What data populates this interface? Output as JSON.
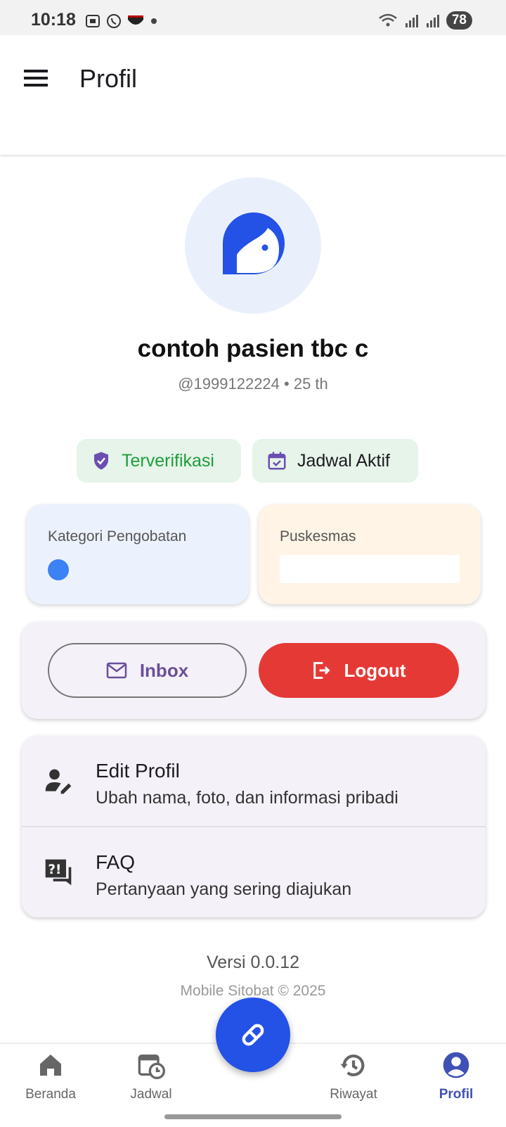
{
  "status": {
    "time": "10:18",
    "battery": "78"
  },
  "appbar": {
    "title": "Profil"
  },
  "profile": {
    "name": "contoh pasien tbc c",
    "subtitle": "@1999122224 • 25 th"
  },
  "chips": {
    "verified": "Terverifikasi",
    "schedule": "Jadwal Aktif"
  },
  "info": {
    "kategori_label": "Kategori Pengobatan",
    "puskesmas_label": "Puskesmas",
    "puskesmas_value": ""
  },
  "actions": {
    "inbox": "Inbox",
    "logout": "Logout"
  },
  "menu": {
    "items": [
      {
        "title": "Edit Profil",
        "desc": "Ubah nama, foto, dan informasi pribadi",
        "icon": "edit-person-icon"
      },
      {
        "title": "FAQ",
        "desc": "Pertanyaan yang sering diajukan",
        "icon": "faq-icon"
      }
    ]
  },
  "footer": {
    "version": "Versi 0.0.12",
    "copyright": "Mobile Sitobat © 2025"
  },
  "nav": {
    "items": [
      {
        "label": "Beranda",
        "icon": "home-icon"
      },
      {
        "label": "Jadwal",
        "icon": "calendar-clock-icon"
      },
      {
        "label": "Riwayat",
        "icon": "history-icon"
      },
      {
        "label": "Profil",
        "icon": "account-circle-icon",
        "active": true
      }
    ]
  },
  "colors": {
    "primary": "#2451e6",
    "logout": "#e53935",
    "verified": "#1f9d3a",
    "active_nav": "#3f51b5"
  }
}
